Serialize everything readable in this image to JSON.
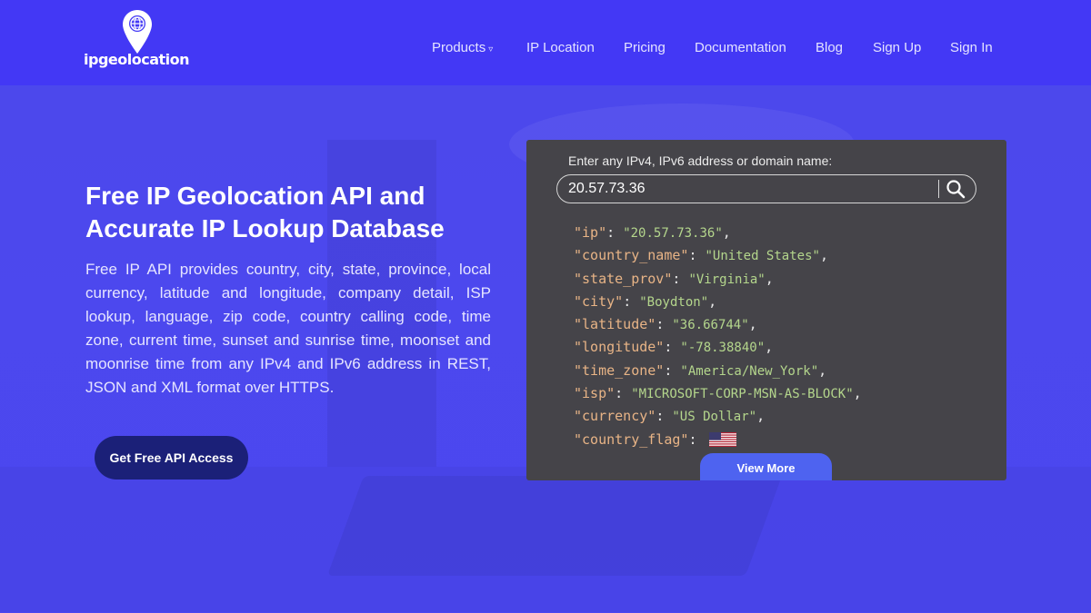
{
  "brand": {
    "name": "ipgeolocation"
  },
  "nav": {
    "items": [
      {
        "label": "Products",
        "caret": "▿"
      },
      {
        "label": "IP Location"
      },
      {
        "label": "Pricing"
      },
      {
        "label": "Documentation"
      },
      {
        "label": "Blog"
      },
      {
        "label": "Sign Up"
      },
      {
        "label": "Sign In"
      }
    ]
  },
  "hero": {
    "title": "Free IP Geolocation API and Accurate IP Lookup Database",
    "description": "Free IP API provides country, city, state, province, local currency, latitude and longitude, company detail, ISP lookup, language, zip code, country calling code, time zone, current time, sunset and sunrise time, moonset and moonrise time from any IPv4 and IPv6 address in REST, JSON and XML format over HTTPS.",
    "cta_label": "Get Free API Access"
  },
  "lookup": {
    "label": "Enter any IPv4, IPv6 address or domain name:",
    "value": "20.57.73.36",
    "search_icon": "search-icon",
    "result": [
      {
        "key": "\"ip\"",
        "value": "\"20.57.73.36\""
      },
      {
        "key": "\"country_name\"",
        "value": "\"United States\""
      },
      {
        "key": "\"state_prov\"",
        "value": "\"Virginia\""
      },
      {
        "key": "\"city\"",
        "value": "\"Boydton\""
      },
      {
        "key": "\"latitude\"",
        "value": "\"36.66744\""
      },
      {
        "key": "\"longitude\"",
        "value": "\"-78.38840\""
      },
      {
        "key": "\"time_zone\"",
        "value": "\"America/New_York\""
      },
      {
        "key": "\"isp\"",
        "value": "\"MICROSOFT-CORP-MSN-AS-BLOCK\""
      },
      {
        "key": "\"currency\"",
        "value": "\"US Dollar\""
      },
      {
        "key": "\"country_flag\"",
        "flag": "us-flag-icon"
      }
    ],
    "view_more_label": "View More"
  },
  "colors": {
    "header_bg": "#4338f5",
    "hero_bg": "#4b47f0",
    "panel_bg": "#454449",
    "cta_bg": "#1b2078",
    "view_more_bg": "#4e63f0",
    "json_key": "#e8b486",
    "json_value": "#b4d68c"
  }
}
